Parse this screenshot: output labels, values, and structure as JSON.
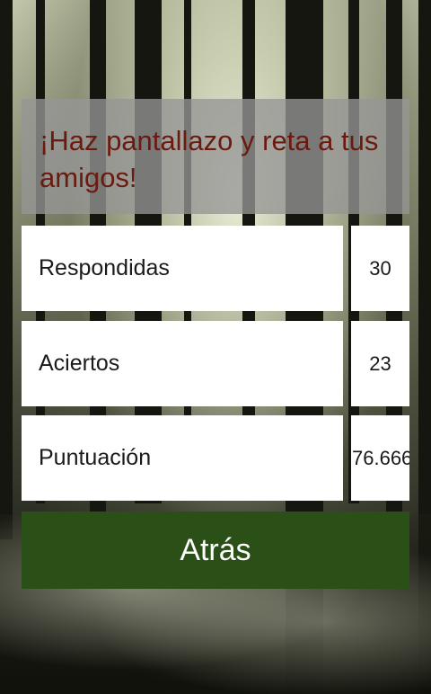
{
  "header": {
    "message": "¡Haz pantallazo y reta a tus amigos!"
  },
  "stats": [
    {
      "label": "Respondidas",
      "value": "30"
    },
    {
      "label": "Aciertos",
      "value": "23"
    },
    {
      "label": "Puntuación",
      "value": "76.666"
    }
  ],
  "actions": {
    "back_label": "Atrás"
  },
  "colors": {
    "header_text": "#6b1a10",
    "back_button": "#2a5018"
  }
}
